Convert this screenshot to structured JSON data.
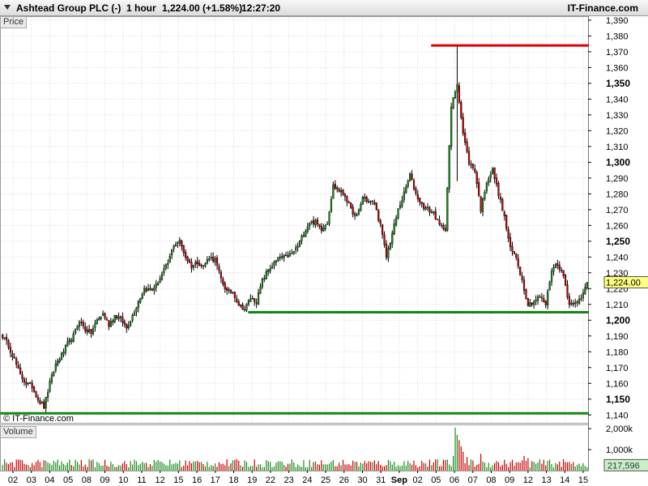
{
  "header": {
    "instrument": "Ashtead Group PLC (-)",
    "timeframe": "1 hour",
    "price_change": "1,224.00 (+1.58%)",
    "time": "12:27:20",
    "brand": "IT-Finance.com"
  },
  "panels": {
    "price_tag": "Price",
    "volume_tag": "Volume",
    "copyright": "© IT-Finance.com"
  },
  "colors": {
    "up_candle": "#1a8a1a",
    "down_candle": "#c80000",
    "support_line": "#118811",
    "resistance_line": "#dd0000",
    "current_price_tag": "#ffff80",
    "volume_tag": "#c8f0c8",
    "grid": "#d8d8d8"
  },
  "chart_data": [
    {
      "type": "candlestick",
      "title": "Ashtead Group PLC (-) 1 hour",
      "ylim": [
        1135,
        1392
      ],
      "y_ticks": [
        "1,390",
        "1,380",
        "1,370",
        "1,360",
        "1,350",
        "1,340",
        "1,330",
        "1,320",
        "1,310",
        "1,300",
        "1,290",
        "1,280",
        "1,270",
        "1,260",
        "1,250",
        "1,240",
        "1,230",
        "1,220",
        "1,210",
        "1,200",
        "1,190",
        "1,180",
        "1,170",
        "1,160",
        "1,150",
        "1,140"
      ],
      "y_ticks_bold": [
        "1,350",
        "1,300",
        "1,250",
        "1,200",
        "1,150"
      ],
      "x_ticks": [
        "02",
        "03",
        "04",
        "05",
        "08",
        "09",
        "10",
        "11",
        "12",
        "15",
        "16",
        "17",
        "18",
        "19",
        "22",
        "23",
        "24",
        "25",
        "26",
        "30",
        "31",
        "Sep",
        "02",
        "05",
        "06",
        "07",
        "08",
        "09",
        "12",
        "13",
        "14",
        "15"
      ],
      "last_price": "1,224.00",
      "path_knots": [
        [
          0,
          1190
        ],
        [
          3,
          1184
        ],
        [
          6,
          1175
        ],
        [
          9,
          1165
        ],
        [
          12,
          1160
        ],
        [
          15,
          1158
        ],
        [
          18,
          1150
        ],
        [
          21,
          1145
        ],
        [
          24,
          1160
        ],
        [
          27,
          1172
        ],
        [
          30,
          1178
        ],
        [
          33,
          1185
        ],
        [
          36,
          1190
        ],
        [
          39,
          1200
        ],
        [
          42,
          1194
        ],
        [
          45,
          1192
        ],
        [
          48,
          1200
        ],
        [
          51,
          1204
        ],
        [
          54,
          1197
        ],
        [
          57,
          1203
        ],
        [
          60,
          1201
        ],
        [
          63,
          1195
        ],
        [
          66,
          1203
        ],
        [
          69,
          1212
        ],
        [
          72,
          1220
        ],
        [
          75,
          1219
        ],
        [
          78,
          1222
        ],
        [
          81,
          1229
        ],
        [
          84,
          1236
        ],
        [
          87,
          1248
        ],
        [
          90,
          1250
        ],
        [
          93,
          1240
        ],
        [
          96,
          1234
        ],
        [
          99,
          1237
        ],
        [
          102,
          1234
        ],
        [
          105,
          1240
        ],
        [
          108,
          1238
        ],
        [
          111,
          1226
        ],
        [
          114,
          1218
        ],
        [
          117,
          1218
        ],
        [
          120,
          1210
        ],
        [
          123,
          1207
        ],
        [
          126,
          1214
        ],
        [
          129,
          1212
        ],
        [
          132,
          1225
        ],
        [
          135,
          1232
        ],
        [
          138,
          1236
        ],
        [
          141,
          1240
        ],
        [
          144,
          1240
        ],
        [
          147,
          1242
        ],
        [
          150,
          1247
        ],
        [
          153,
          1255
        ],
        [
          156,
          1262
        ],
        [
          159,
          1262
        ],
        [
          162,
          1258
        ],
        [
          165,
          1262
        ],
        [
          168,
          1285
        ],
        [
          171,
          1282
        ],
        [
          174,
          1279
        ],
        [
          177,
          1270
        ],
        [
          180,
          1265
        ],
        [
          183,
          1278
        ],
        [
          186,
          1275
        ],
        [
          189,
          1274
        ],
        [
          192,
          1260
        ],
        [
          195,
          1240
        ],
        [
          198,
          1255
        ],
        [
          201,
          1270
        ],
        [
          204,
          1280
        ],
        [
          207,
          1292
        ],
        [
          210,
          1280
        ],
        [
          213,
          1273
        ],
        [
          216,
          1270
        ],
        [
          219,
          1268
        ],
        [
          222,
          1260
        ],
        [
          225,
          1258
        ],
        [
          228,
          1335
        ],
        [
          231,
          1350
        ],
        [
          234,
          1318
        ],
        [
          237,
          1300
        ],
        [
          240,
          1295
        ],
        [
          243,
          1270
        ],
        [
          246,
          1288
        ],
        [
          249,
          1295
        ],
        [
          252,
          1280
        ],
        [
          255,
          1265
        ],
        [
          258,
          1245
        ],
        [
          261,
          1240
        ],
        [
          264,
          1225
        ],
        [
          267,
          1210
        ],
        [
          270,
          1212
        ],
        [
          273,
          1215
        ],
        [
          276,
          1210
        ],
        [
          279,
          1232
        ],
        [
          282,
          1236
        ],
        [
          285,
          1228
        ],
        [
          288,
          1210
        ],
        [
          291,
          1212
        ],
        [
          294,
          1213
        ],
        [
          297,
          1224
        ]
      ],
      "spike": {
        "index": 231,
        "high": 1374
      },
      "levels": [
        {
          "color": "red",
          "value": 1374,
          "from_index": 219,
          "to_index": 297
        },
        {
          "color": "green",
          "value": 1205,
          "from_index": 126,
          "to_index": 297
        },
        {
          "color": "green",
          "value": 1141,
          "from_index": 0,
          "to_index": 297
        }
      ]
    },
    {
      "type": "bar",
      "title": "Volume",
      "ylim": [
        0,
        2200
      ],
      "y_unit": "k",
      "y_ticks": [
        "2,000k",
        "1,000k"
      ],
      "last_volume": "217,596",
      "typical_range_k": [
        150,
        550
      ],
      "peak_bars": [
        {
          "index": 230,
          "value_k": 2050
        },
        {
          "index": 231,
          "value_k": 1700
        },
        {
          "index": 232,
          "value_k": 1450
        },
        {
          "index": 233,
          "value_k": 1150
        },
        {
          "index": 229,
          "value_k": 700
        },
        {
          "index": 234,
          "value_k": 900
        },
        {
          "index": 236,
          "value_k": 650
        },
        {
          "index": 243,
          "value_k": 800
        },
        {
          "index": 265,
          "value_k": 700
        },
        {
          "index": 267,
          "value_k": 600
        }
      ]
    }
  ]
}
